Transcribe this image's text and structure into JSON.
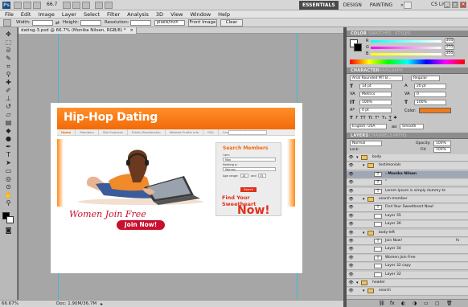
{
  "app": {
    "logo": "Ps",
    "zoom_display": "66.7",
    "workspaces": [
      "ESSENTIALS",
      "DESIGN",
      "PAINTING",
      "»"
    ],
    "cs_live": "CS Live"
  },
  "menu": [
    "File",
    "Edit",
    "Image",
    "Layer",
    "Select",
    "Filter",
    "Analysis",
    "3D",
    "View",
    "Window",
    "Help"
  ],
  "options_bar": {
    "width_label": "Width:",
    "height_label": "Height:",
    "resolution_label": "Resolution:",
    "unit": "pixels/inch",
    "front_image": "Front Image",
    "clear": "Clear"
  },
  "document": {
    "tab_title": "dating-3.psd @ 66.7% (Monika Nilsen, RGB/8) *",
    "status_zoom": "66.67%",
    "status_doc": "Doc: 1.90M/36.7M"
  },
  "site": {
    "title": "Hip-Hop Dating",
    "nav": [
      "Home",
      "Members",
      "Site Features",
      "Public Membership",
      "Website Profile Info",
      "FAQ",
      "Contact Info"
    ],
    "tagline": "Women Join Free",
    "join_button": "Join Now!",
    "search": {
      "title": "Search Members",
      "i_am": "I am:",
      "i_am_value": "Man",
      "seeking": "Seeking a:",
      "seeking_value": "Woman",
      "age_range": "Age range:",
      "age_from": "18",
      "and": "and",
      "age_to": "35",
      "search_button": "Search",
      "find_text": "Find Your Sweetheart",
      "now": "Now!"
    }
  },
  "panels": {
    "color_tabs": [
      "COLOR",
      "SWATCHES",
      "STYLES"
    ],
    "color": {
      "r": "255",
      "g": "255",
      "b": "255",
      "r_label": "R",
      "g_label": "G",
      "b_label": "B"
    },
    "character_tabs": [
      "CHARACTER",
      "PARAGRAPH"
    ],
    "character": {
      "font": "Arial Rounded MT B...",
      "style": "Regular",
      "size": "14 pt",
      "leading": "20 pt",
      "tracking_metric": "Metrics",
      "tracking": "0",
      "scale_v": "100%",
      "scale_h": "100%",
      "baseline": "0 pt",
      "color_label": "Color:",
      "language": "English: USA",
      "aa": "Smooth",
      "aa_label": "aɑ"
    },
    "layers_tabs": [
      "LAYERS",
      "CHANNELS",
      "PATHS"
    ],
    "layers_blend": "Normal",
    "layers_opacity_label": "Opacity:",
    "layers_opacity": "100%",
    "layers_lock_label": "Lock:",
    "layers_fill_label": "Fill:",
    "layers_fill": "100%",
    "layers": [
      {
        "name": "body",
        "type": "group",
        "indent": 0
      },
      {
        "name": "testimonials",
        "type": "group",
        "indent": 1
      },
      {
        "name": "- Monika Nilsen",
        "type": "text",
        "indent": 2,
        "selected": true
      },
      {
        "name": "\"",
        "type": "text",
        "indent": 2
      },
      {
        "name": "Lorem Ipsum is simply dummy te",
        "type": "text",
        "indent": 2
      },
      {
        "name": "search-member",
        "type": "group",
        "indent": 1
      },
      {
        "name": "Find Your Sweetheart Now!",
        "type": "text",
        "indent": 2
      },
      {
        "name": "Layer 35",
        "type": "layer",
        "indent": 2
      },
      {
        "name": "Layer 36",
        "type": "layer",
        "indent": 2
      },
      {
        "name": "body-left",
        "type": "group",
        "indent": 1
      },
      {
        "name": "Join Now!",
        "type": "text",
        "indent": 2,
        "fx": true
      },
      {
        "name": "Layer 34",
        "type": "layer",
        "indent": 2
      },
      {
        "name": "Women Join Free",
        "type": "text",
        "indent": 2
      },
      {
        "name": "Layer 32 copy",
        "type": "layer",
        "indent": 2
      },
      {
        "name": "Layer 32",
        "type": "layer",
        "indent": 2
      },
      {
        "name": "header",
        "type": "group",
        "indent": 0
      },
      {
        "name": "search",
        "type": "group",
        "indent": 1
      }
    ]
  }
}
